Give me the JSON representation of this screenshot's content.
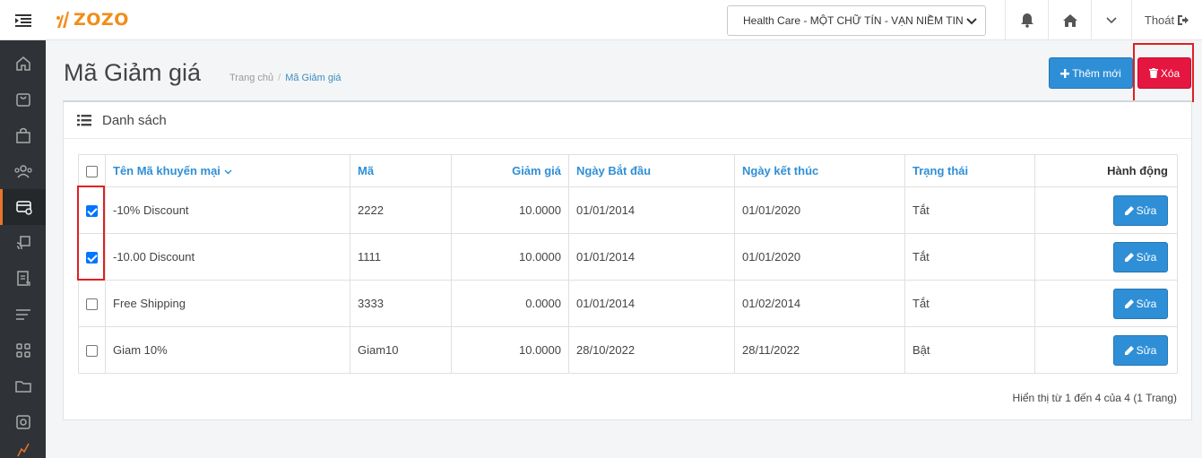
{
  "brand": {
    "logo_text": "ZOZO",
    "accent": "#f28c18"
  },
  "topbar": {
    "store_select": "Health Care - MỘT CHỮ TÍN - VẠN NIỀM TIN",
    "logout_label": "Thoát"
  },
  "sidebar": {
    "items": [
      "home-icon",
      "shopping-bag-icon",
      "bag-icon",
      "users-icon",
      "coupon-icon",
      "cast-icon",
      "report-icon",
      "menu-lines-icon",
      "apps-icon",
      "folder-icon",
      "settings-icon",
      "chart-icon"
    ]
  },
  "header": {
    "title": "Mã Giảm giá",
    "breadcrumb": {
      "home": "Trang chủ",
      "separator": "/",
      "current": "Mã Giảm giá"
    },
    "add_label": "Thêm mới",
    "delete_label": "Xóa"
  },
  "panel": {
    "title": "Danh sách",
    "columns": [
      "Tên Mã khuyến mại",
      "Mã",
      "Giảm giá",
      "Ngày Bắt đầu",
      "Ngày kết thúc",
      "Trạng thái",
      "Hành động"
    ],
    "rows": [
      {
        "checked": true,
        "name": "-10% Discount",
        "code": "2222",
        "discount": "10.0000",
        "start": "01/01/2014",
        "end": "01/01/2020",
        "status": "Tắt",
        "action": "Sửa"
      },
      {
        "checked": true,
        "name": "-10.00 Discount",
        "code": "1111",
        "discount": "10.0000",
        "start": "01/01/2014",
        "end": "01/01/2020",
        "status": "Tắt",
        "action": "Sửa"
      },
      {
        "checked": false,
        "name": "Free Shipping",
        "code": "3333",
        "discount": "0.0000",
        "start": "01/01/2014",
        "end": "01/02/2014",
        "status": "Tắt",
        "action": "Sửa"
      },
      {
        "checked": false,
        "name": "Giam 10%",
        "code": "Giam10",
        "discount": "10.0000",
        "start": "28/10/2022",
        "end": "28/11/2022",
        "status": "Bật",
        "action": "Sửa"
      }
    ],
    "pagination_info": "Hiển thị từ 1 đến 4 của 4 (1 Trang)"
  },
  "colors": {
    "primary": "#2f8fd6",
    "danger": "#e5163f",
    "sidebar": "#2f3337"
  }
}
